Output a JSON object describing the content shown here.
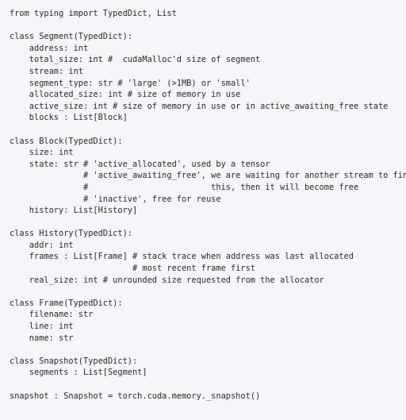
{
  "lines": [
    "from typing import TypedDict, List",
    "",
    "class Segment(TypedDict):",
    "    address: int",
    "    total_size: int #  cudaMalloc'd size of segment",
    "    stream: int",
    "    segment_type: str # 'large' (>1MB) or 'small'",
    "    allocated_size: int # size of memory in use",
    "    active_size: int # size of memory in use or in active_awaiting_free state",
    "    blocks : List[Block]",
    "",
    "class Block(TypedDict):",
    "    size: int",
    "    state: str # 'active_allocated', used by a tensor",
    "               # 'active_awaiting_free', we are waiting for another stream to finish using",
    "               #                         this, then it will become free",
    "               # 'inactive', free for reuse",
    "    history: List[History]",
    "",
    "class History(TypedDict):",
    "    addr: int",
    "    frames : List[Frame] # stack trace when address was last allocated",
    "                         # most recent frame first",
    "    real_size: int # unrounded size requested from the allocator",
    "",
    "class Frame(TypedDict):",
    "    filename: str",
    "    line: int",
    "    name: str",
    "",
    "class Snapshot(TypedDict):",
    "    segments : List[Segment]",
    "",
    "snapshot : Snapshot = torch.cuda.memory._snapshot()"
  ]
}
